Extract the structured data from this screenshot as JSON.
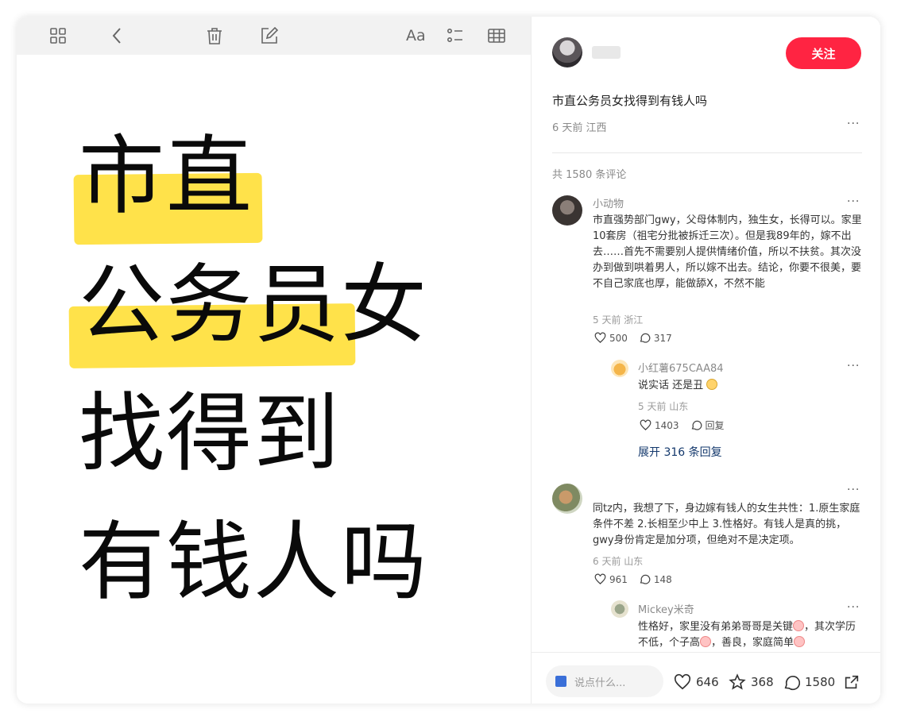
{
  "note": {
    "lines": [
      "市直",
      "公务员女",
      "找得到",
      "有钱人吗"
    ],
    "highlight_color": "#ffe24a"
  },
  "toolbar": {
    "icons": [
      "grid-icon",
      "back-icon",
      "trash-icon",
      "edit-icon",
      "font-icon",
      "checklist-icon",
      "table-icon"
    ],
    "font_label": "Aa"
  },
  "post": {
    "follow_label": "关注",
    "title": "市直公务员女找得到有钱人吗",
    "meta": "6 天前 江西",
    "comment_count": "共 1580 条评论",
    "accent": "#ff2442"
  },
  "comments": [
    {
      "name": "小动物",
      "text": "市直强势部门gwy，父母体制内，独生女，长得可以。家里10套房（祖宅分批被拆迁三次）。但是我89年的，嫁不出去……首先不需要别人提供情绪价值，所以不扶贫。其次没办到做到哄着男人，所以嫁不出去。结论，你要不很美，要不自己家底也厚，能做舔X，不然不能",
      "meta": "5 天前 浙江",
      "likes": "500",
      "replies": "317",
      "reply": {
        "name": "小红薯675CAA84",
        "text": "说实话 还是丑",
        "meta": "5 天前 山东",
        "likes": "1403",
        "reply_label": "回复"
      },
      "expand_label": "展开 316 条回复"
    },
    {
      "name": "",
      "text": "同tz内，我想了下，身边嫁有钱人的女生共性：1.原生家庭条件不差 2.长相至少中上 3.性格好。有钱人是真的挑，gwy身份肯定是加分项，但绝对不是决定项。",
      "meta": "6 天前 山东",
      "likes": "961",
      "replies": "148",
      "reply": {
        "name": "Mickey米奇",
        "text_a": "性格好，家里没有弟弟哥哥是关键",
        "text_b": "，其次学历不低，个子高",
        "text_c": "，善良，家庭简单"
      }
    }
  ],
  "bottom": {
    "placeholder": "说点什么...",
    "likes": "646",
    "stars": "368",
    "comments": "1580"
  }
}
